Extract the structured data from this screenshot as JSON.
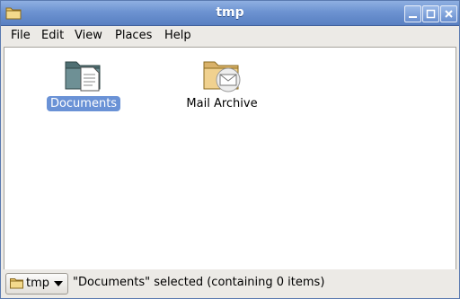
{
  "window": {
    "title": "tmp"
  },
  "menubar": [
    {
      "label": "File"
    },
    {
      "label": "Edit"
    },
    {
      "label": "View"
    },
    {
      "label": "Places"
    },
    {
      "label": "Help"
    }
  ],
  "items": [
    {
      "label": "Documents",
      "icon": "documents-folder-icon",
      "selected": true
    },
    {
      "label": "Mail Archive",
      "icon": "mail-folder-icon",
      "selected": false
    }
  ],
  "statusbar": {
    "location_label": "tmp",
    "status_text": "\"Documents\" selected (containing 0 items)"
  }
}
